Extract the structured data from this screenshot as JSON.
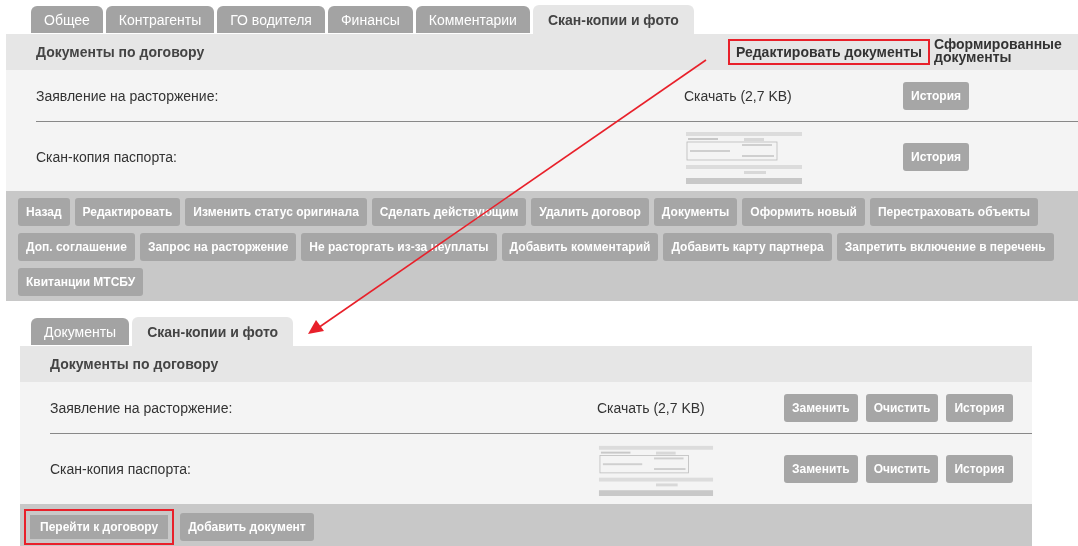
{
  "top_panel": {
    "tabs": [
      {
        "label": "Общее",
        "selected": false
      },
      {
        "label": "Контрагенты",
        "selected": false
      },
      {
        "label": "ГО водителя",
        "selected": false
      },
      {
        "label": "Финансы",
        "selected": false
      },
      {
        "label": "Комментарии",
        "selected": false
      },
      {
        "label": "Скан-копии и фото",
        "selected": true
      }
    ],
    "header": {
      "title": "Документы по договору",
      "links": [
        {
          "label": "Редактировать документы",
          "highlighted": true
        },
        {
          "label": "Сформированные документы",
          "highlighted": false
        }
      ]
    },
    "documents": [
      {
        "name": "Заявление на расторжение:",
        "file": {
          "kind": "download",
          "text": "Скачать (2,7 KB)"
        },
        "buttons": [
          {
            "label": "История"
          }
        ]
      },
      {
        "name": "Скан-копия паспорта:",
        "file": {
          "kind": "picture"
        },
        "buttons": [
          {
            "label": "История"
          }
        ]
      }
    ],
    "buttons": [
      {
        "label": "Назад",
        "highlighted": false
      },
      {
        "label": "Редактировать",
        "highlighted": false
      },
      {
        "label": "Изменить статус оригинала",
        "highlighted": false
      },
      {
        "label": "Сделать действующим",
        "highlighted": false
      },
      {
        "label": "Удалить договор",
        "highlighted": false
      },
      {
        "label": "Документы",
        "highlighted": false
      },
      {
        "label": "Оформить новый",
        "highlighted": false
      },
      {
        "label": "Перестраховать объекты",
        "highlighted": false
      },
      {
        "label": "Доп. соглашение",
        "highlighted": false
      },
      {
        "label": "Запрос на расторжение",
        "highlighted": false
      },
      {
        "label": "Не расторгать из-за неуплаты",
        "highlighted": false
      },
      {
        "label": "Добавить комментарий",
        "highlighted": false
      },
      {
        "label": "Добавить карту партнера",
        "highlighted": false
      },
      {
        "label": "Запретить включение в перечень",
        "highlighted": false
      },
      {
        "label": "Квитанции МТСБУ",
        "highlighted": false
      }
    ]
  },
  "bottom_panel": {
    "tabs": [
      {
        "label": "Документы",
        "selected": false
      },
      {
        "label": "Скан-копии и фото",
        "selected": true
      }
    ],
    "header": {
      "title": "Документы по договору"
    },
    "documents": [
      {
        "name": "Заявление на расторжение:",
        "file": {
          "kind": "download",
          "text": "Скачать (2,7 KB)"
        },
        "buttons": [
          {
            "label": "Заменить"
          },
          {
            "label": "Очистить"
          },
          {
            "label": "История"
          }
        ]
      },
      {
        "name": "Скан-копия паспорта:",
        "file": {
          "kind": "picture"
        },
        "buttons": [
          {
            "label": "Заменить"
          },
          {
            "label": "Очистить"
          },
          {
            "label": "История"
          }
        ]
      }
    ],
    "buttons": [
      {
        "label": "Перейти к договору",
        "highlighted": true
      },
      {
        "label": "Добавить документ",
        "highlighted": false
      }
    ]
  }
}
